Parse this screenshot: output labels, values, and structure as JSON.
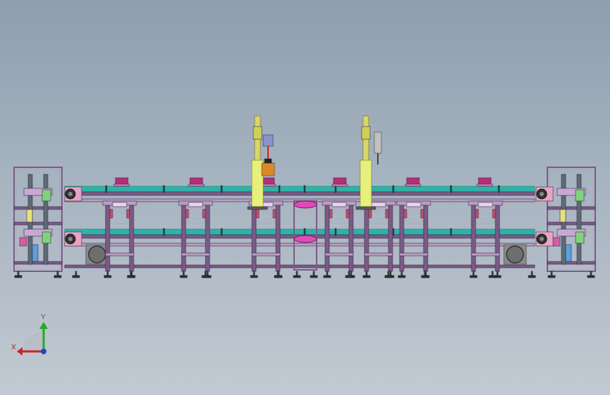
{
  "viewport": {
    "background_top": "#8e9eae",
    "background_bottom": "#c2c9d2"
  },
  "colors": {
    "frame_purple": "#7a5a86",
    "frame_light": "#b99cc4",
    "belt_teal": "#2fb3a8",
    "belt_dark": "#1c7e78",
    "pallet_magenta": "#b0307a",
    "column_yellow": "#e6f07a",
    "guard_pink": "#e8a4c4",
    "motor_gray": "#6e6e6e",
    "axis_y": "#22aa22",
    "axis_x": "#cc2222",
    "axis_z": "#2244cc"
  },
  "axis_triad": {
    "y_label": "Y",
    "x_label": "X"
  },
  "assembly": {
    "stations_count": 8,
    "pallets_count": 6,
    "robot_columns_count": 2
  }
}
